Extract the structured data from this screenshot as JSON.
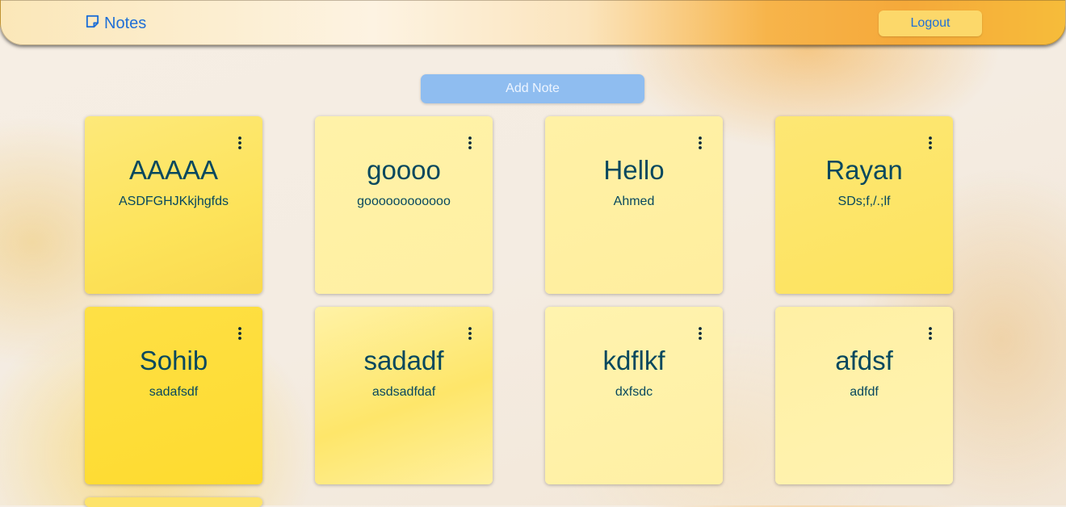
{
  "navbar": {
    "brand_label": "Notes",
    "brand_icon": "sticky-note-icon",
    "logout_label": "Logout"
  },
  "actions": {
    "add_note_label": "Add Note"
  },
  "notes": [
    {
      "title": "AAAAA",
      "body": "ASDFGHJKkjhgfds"
    },
    {
      "title": "goooo",
      "body": "goooooooooooo"
    },
    {
      "title": "Hello",
      "body": "Ahmed"
    },
    {
      "title": "Rayan",
      "body": "SDs;f,/.;lf"
    },
    {
      "title": "Sohib",
      "body": "sadafsdf"
    },
    {
      "title": "sadadf",
      "body": "asdsadfdaf"
    },
    {
      "title": "kdflkf",
      "body": "dxfsdc"
    },
    {
      "title": "afdsf",
      "body": "adfdf"
    }
  ],
  "colors": {
    "accent": "#1f6fd6",
    "note_text": "#07485e",
    "add_button": "#8fbdf0",
    "logout_button": "#fcd86a"
  }
}
